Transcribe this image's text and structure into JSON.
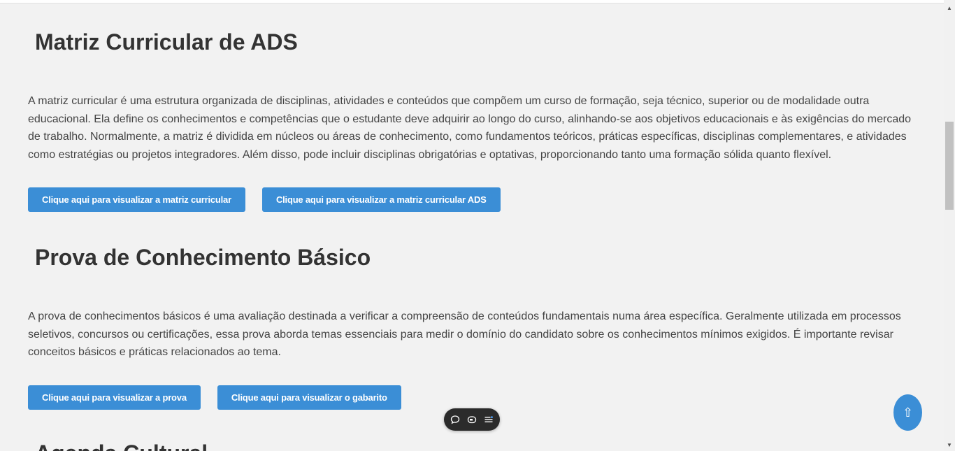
{
  "sections": [
    {
      "title": "Matriz Curricular de ADS",
      "text": "A matriz curricular é uma estrutura organizada de disciplinas, atividades e conteúdos que compõem um curso de formação, seja técnico, superior ou de modalidade outra educacional. Ela define os conhecimentos e competências que o estudante deve adquirir ao longo do curso, alinhando-se aos objetivos educacionais e às exigências do mercado de trabalho. Normalmente, a matriz é dividida em núcleos ou áreas de conhecimento, como fundamentos teóricos, práticas específicas, disciplinas complementares, e atividades como estratégias ou projetos integradores. Além disso, pode incluir disciplinas obrigatórias e optativas, proporcionando tanto uma formação sólida quanto flexível.",
      "buttons": [
        "Clique aqui para visualizar a matriz curricular",
        "Clique aqui para visualizar a matriz curricular ADS"
      ]
    },
    {
      "title": "Prova de Conhecimento Básico",
      "text": "A prova de conhecimentos básicos é uma avaliação destinada a verificar a compreensão de conteúdos fundamentais numa área específica. Geralmente utilizada em processos seletivos, concursos ou certificações, essa prova aborda temas essenciais para medir o domínio do candidato sobre os conhecimentos mínimos exigidos. É importante revisar conceitos básicos e práticas relacionados ao tema.",
      "buttons": [
        "Clique aqui para visualizar a prova",
        "Clique aqui para visualizar o gabarito"
      ]
    },
    {
      "title": "Agenda Cultural"
    }
  ],
  "back_to_top_label": "⇧",
  "colors": {
    "button": "#3b8ed6",
    "background": "#f2f2f2",
    "toolbar": "#2b2b2b"
  },
  "icons": [
    "comment-icon",
    "caption-icon",
    "menu-list-icon",
    "arrow-up-icon"
  ]
}
